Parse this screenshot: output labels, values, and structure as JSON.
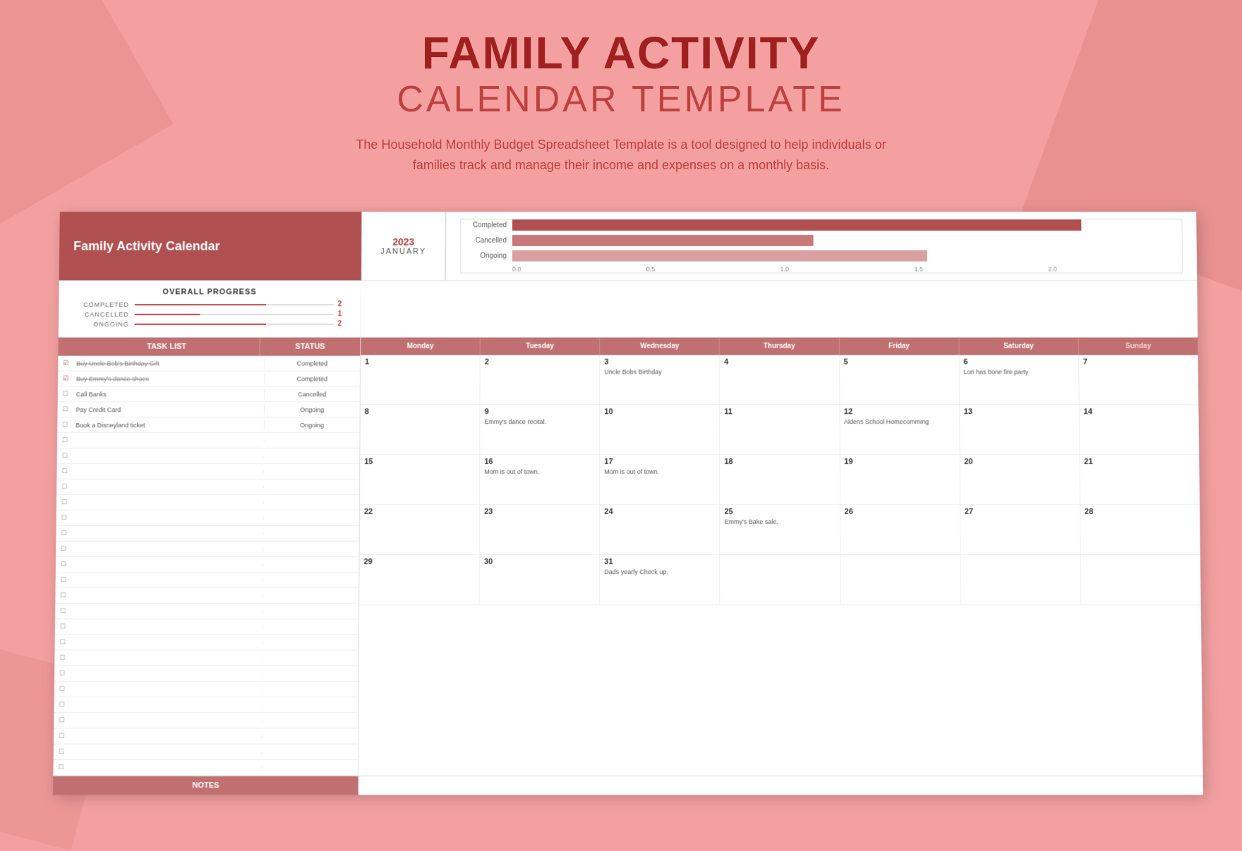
{
  "header": {
    "title_main": "FAMILY ACTIVITY",
    "title_sub": "CALENDAR TEMPLATE",
    "description": "The Household Monthly Budget Spreadsheet Template is a tool designed to help individuals or families track and manage their income and expenses on a monthly basis."
  },
  "spreadsheet": {
    "title": "Family Activity Calendar",
    "year": "2023",
    "month": "JANUARY",
    "progress": {
      "title": "OVERALL PROGRESS",
      "completed_label": "COMPLETED",
      "completed_value": "2",
      "cancelled_label": "CANCELLED",
      "cancelled_value": "1",
      "ongoing_label": "ONGOING",
      "ongoing_value": "2"
    },
    "chart": {
      "completed_label": "Completed",
      "cancelled_label": "Cancelled",
      "ongoing_label": "Ongoing",
      "axis": [
        "0.0",
        "0.5",
        "1.0",
        "1.5",
        "2.0"
      ]
    },
    "task_header": {
      "task_list": "TASK LIST",
      "status": "STATUS"
    },
    "tasks": [
      {
        "checked": true,
        "name": "Buy Uncle Bob's Birthday Gift",
        "status": "Completed",
        "strikethrough": true
      },
      {
        "checked": true,
        "name": "Buy Emmy's dance shoes",
        "status": "Completed",
        "strikethrough": true
      },
      {
        "checked": false,
        "name": "Call Banks",
        "status": "Cancelled",
        "strikethrough": false
      },
      {
        "checked": false,
        "name": "Pay Credit Card",
        "status": "Ongoing",
        "strikethrough": false
      },
      {
        "checked": false,
        "name": "Book a Disneyland ticket",
        "status": "Ongoing",
        "strikethrough": false
      },
      {
        "checked": false,
        "name": "",
        "status": "",
        "strikethrough": false
      },
      {
        "checked": false,
        "name": "",
        "status": "",
        "strikethrough": false
      },
      {
        "checked": false,
        "name": "",
        "status": "",
        "strikethrough": false
      },
      {
        "checked": false,
        "name": "",
        "status": "",
        "strikethrough": false
      },
      {
        "checked": false,
        "name": "",
        "status": "",
        "strikethrough": false
      },
      {
        "checked": false,
        "name": "",
        "status": "",
        "strikethrough": false
      },
      {
        "checked": false,
        "name": "",
        "status": "",
        "strikethrough": false
      },
      {
        "checked": false,
        "name": "",
        "status": "",
        "strikethrough": false
      },
      {
        "checked": false,
        "name": "",
        "status": "",
        "strikethrough": false
      },
      {
        "checked": false,
        "name": "",
        "status": "",
        "strikethrough": false
      },
      {
        "checked": false,
        "name": "",
        "status": "",
        "strikethrough": false
      },
      {
        "checked": false,
        "name": "",
        "status": "",
        "strikethrough": false
      },
      {
        "checked": false,
        "name": "",
        "status": "",
        "strikethrough": false
      },
      {
        "checked": false,
        "name": "",
        "status": "",
        "strikethrough": false
      },
      {
        "checked": false,
        "name": "",
        "status": "",
        "strikethrough": false
      },
      {
        "checked": false,
        "name": "",
        "status": "",
        "strikethrough": false
      },
      {
        "checked": false,
        "name": "",
        "status": "",
        "strikethrough": false
      },
      {
        "checked": false,
        "name": "",
        "status": "",
        "strikethrough": false
      },
      {
        "checked": false,
        "name": "",
        "status": "",
        "strikethrough": false
      },
      {
        "checked": false,
        "name": "",
        "status": "",
        "strikethrough": false
      },
      {
        "checked": false,
        "name": "",
        "status": "",
        "strikethrough": false
      },
      {
        "checked": false,
        "name": "",
        "status": "",
        "strikethrough": false
      }
    ],
    "calendar_days": [
      "Monday",
      "Tuesday",
      "Wednesday",
      "Thursday",
      "Friday",
      "Saturday",
      "Sunday"
    ],
    "weeks": [
      [
        {
          "num": "1",
          "events": []
        },
        {
          "num": "2",
          "events": []
        },
        {
          "num": "3",
          "events": [
            "Uncle Bobs Birthday"
          ]
        },
        {
          "num": "4",
          "events": []
        },
        {
          "num": "5",
          "events": []
        },
        {
          "num": "6",
          "events": [
            "Lori has bone fire party"
          ]
        },
        {
          "num": "7",
          "events": []
        }
      ],
      [
        {
          "num": "8",
          "events": []
        },
        {
          "num": "9",
          "events": [
            "Emmy's dance recital."
          ]
        },
        {
          "num": "10",
          "events": []
        },
        {
          "num": "11",
          "events": []
        },
        {
          "num": "12",
          "events": [
            "Aldens School Homecomming"
          ]
        },
        {
          "num": "13",
          "events": []
        },
        {
          "num": "14",
          "events": []
        }
      ],
      [
        {
          "num": "15",
          "events": []
        },
        {
          "num": "16",
          "events": [
            "Mom is out of town."
          ]
        },
        {
          "num": "17",
          "events": [
            "Mom is out of town."
          ]
        },
        {
          "num": "18",
          "events": []
        },
        {
          "num": "19",
          "events": []
        },
        {
          "num": "20",
          "events": []
        },
        {
          "num": "21",
          "events": []
        }
      ],
      [
        {
          "num": "22",
          "events": []
        },
        {
          "num": "23",
          "events": []
        },
        {
          "num": "24",
          "events": []
        },
        {
          "num": "25",
          "events": [
            "Emmy's Bake sale."
          ]
        },
        {
          "num": "26",
          "events": []
        },
        {
          "num": "27",
          "events": []
        },
        {
          "num": "28",
          "events": []
        }
      ],
      [
        {
          "num": "29",
          "events": []
        },
        {
          "num": "30",
          "events": []
        },
        {
          "num": "31",
          "events": [
            "Dads yearly Check up."
          ]
        },
        {
          "num": "",
          "events": [],
          "greyed": true
        },
        {
          "num": "",
          "events": [],
          "greyed": true
        },
        {
          "num": "",
          "events": [],
          "greyed": true
        },
        {
          "num": "",
          "events": [],
          "greyed": true
        }
      ]
    ],
    "notes_label": "NOTES"
  }
}
